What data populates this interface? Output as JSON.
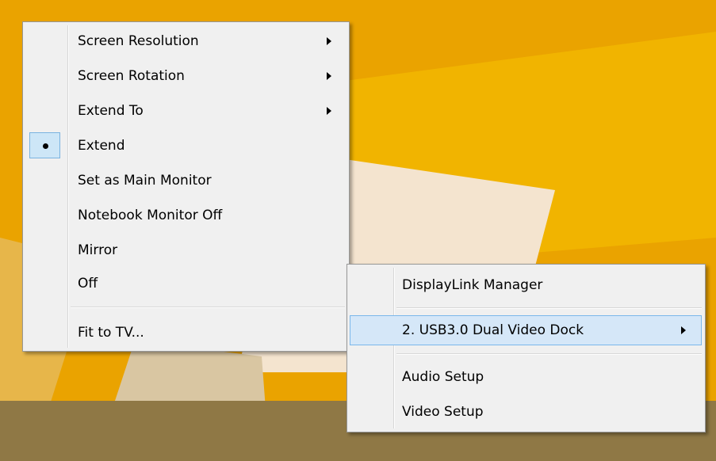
{
  "main_menu": {
    "items": [
      {
        "label": "Screen Resolution",
        "submenu": true
      },
      {
        "label": "Screen Rotation",
        "submenu": true
      },
      {
        "label": "Extend To",
        "submenu": true
      },
      {
        "label": "Extend",
        "checked": true
      },
      {
        "label": "Set as Main Monitor"
      },
      {
        "label": "Notebook Monitor Off"
      },
      {
        "label": "Mirror"
      },
      {
        "label": "Off"
      },
      {
        "label": "Fit to TV..."
      }
    ]
  },
  "tray_menu": {
    "items": [
      {
        "label": "DisplayLink Manager"
      },
      {
        "label": "2. USB3.0 Dual Video Dock",
        "submenu": true,
        "highlighted": true
      },
      {
        "label": "Audio Setup"
      },
      {
        "label": "Video Setup"
      }
    ]
  },
  "taskbar": {
    "icons": [
      "keyboard-icon",
      "displaylink-tray-icon"
    ]
  },
  "colors": {
    "desktop_orange": "#e9a200",
    "menu_bg": "#f0f0f0",
    "highlight_bg": "#d5e7f8",
    "highlight_border": "#7ab7eb"
  }
}
